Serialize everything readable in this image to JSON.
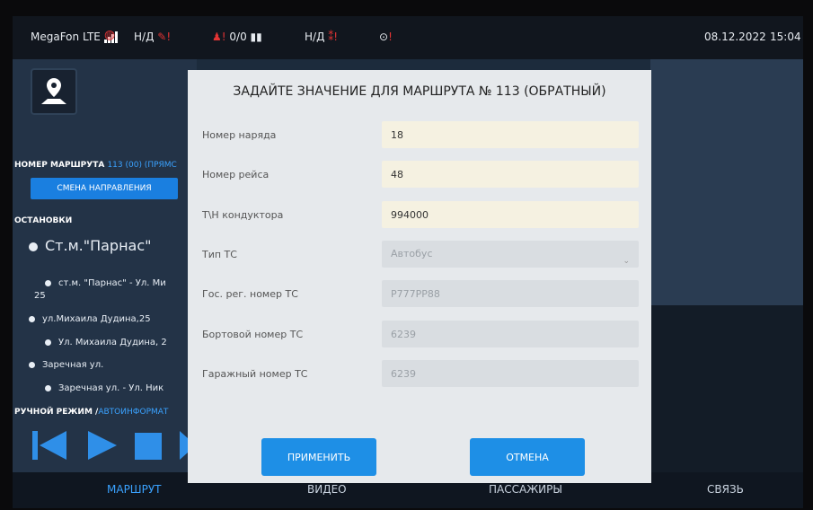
{
  "status_bar": {
    "carrier": "MegaFon LTE",
    "gps_status": "Н/Д",
    "counter": "0/0",
    "second_status": "Н/Д",
    "date": "08.12.2022",
    "time": "15:04"
  },
  "left_panel": {
    "route_label": "НОМЕР МАРШРУТА",
    "route_value": "113 (00) (ПРЯМС",
    "direction_button": "СМЕНА НАПРАВЛЕНИЯ",
    "stops_label": "ОСТАНОВКИ",
    "stops": [
      "Ст.м.\"Парнас\"",
      "ст.м. \"Парнас\" - Ул. Ми",
      "25",
      "ул.Михаила Дудина,25",
      "Ул. Михаила Дудина, 2",
      "Заречная ул.",
      "Заречная ул. - Ул. Ник"
    ],
    "mode_manual": "РУЧНОЙ РЕЖИМ /",
    "mode_auto": "АВТОИНФОРМАТ"
  },
  "dialog": {
    "title": "ЗАДАЙТЕ ЗНАЧЕНИЕ ДЛЯ МАРШРУТА № 113 (ОБРАТНЫЙ)",
    "fields": [
      {
        "label": "Номер наряда",
        "value": "18"
      },
      {
        "label": "Номер рейса",
        "value": "48"
      },
      {
        "label": "Т\\Н кондуктора",
        "value": "994000"
      },
      {
        "label": "Тип ТС",
        "value": "Автобус"
      },
      {
        "label": "Гос. рег. номер ТС",
        "value": "Р777РР88"
      },
      {
        "label": "Бортовой номер ТС",
        "value": "6239"
      },
      {
        "label": "Гаражный номер ТС",
        "value": "6239"
      }
    ],
    "apply_button": "ПРИМЕНИТЬ",
    "cancel_button": "ОТМЕНА"
  },
  "bottom_nav": [
    "МАРШРУТ",
    "ВИДЕО",
    "ПАССАЖИРЫ",
    "СВЯЗЬ"
  ],
  "colors": {
    "accent": "#1e8fe6",
    "alert": "#e33434",
    "panel": "#233347"
  }
}
